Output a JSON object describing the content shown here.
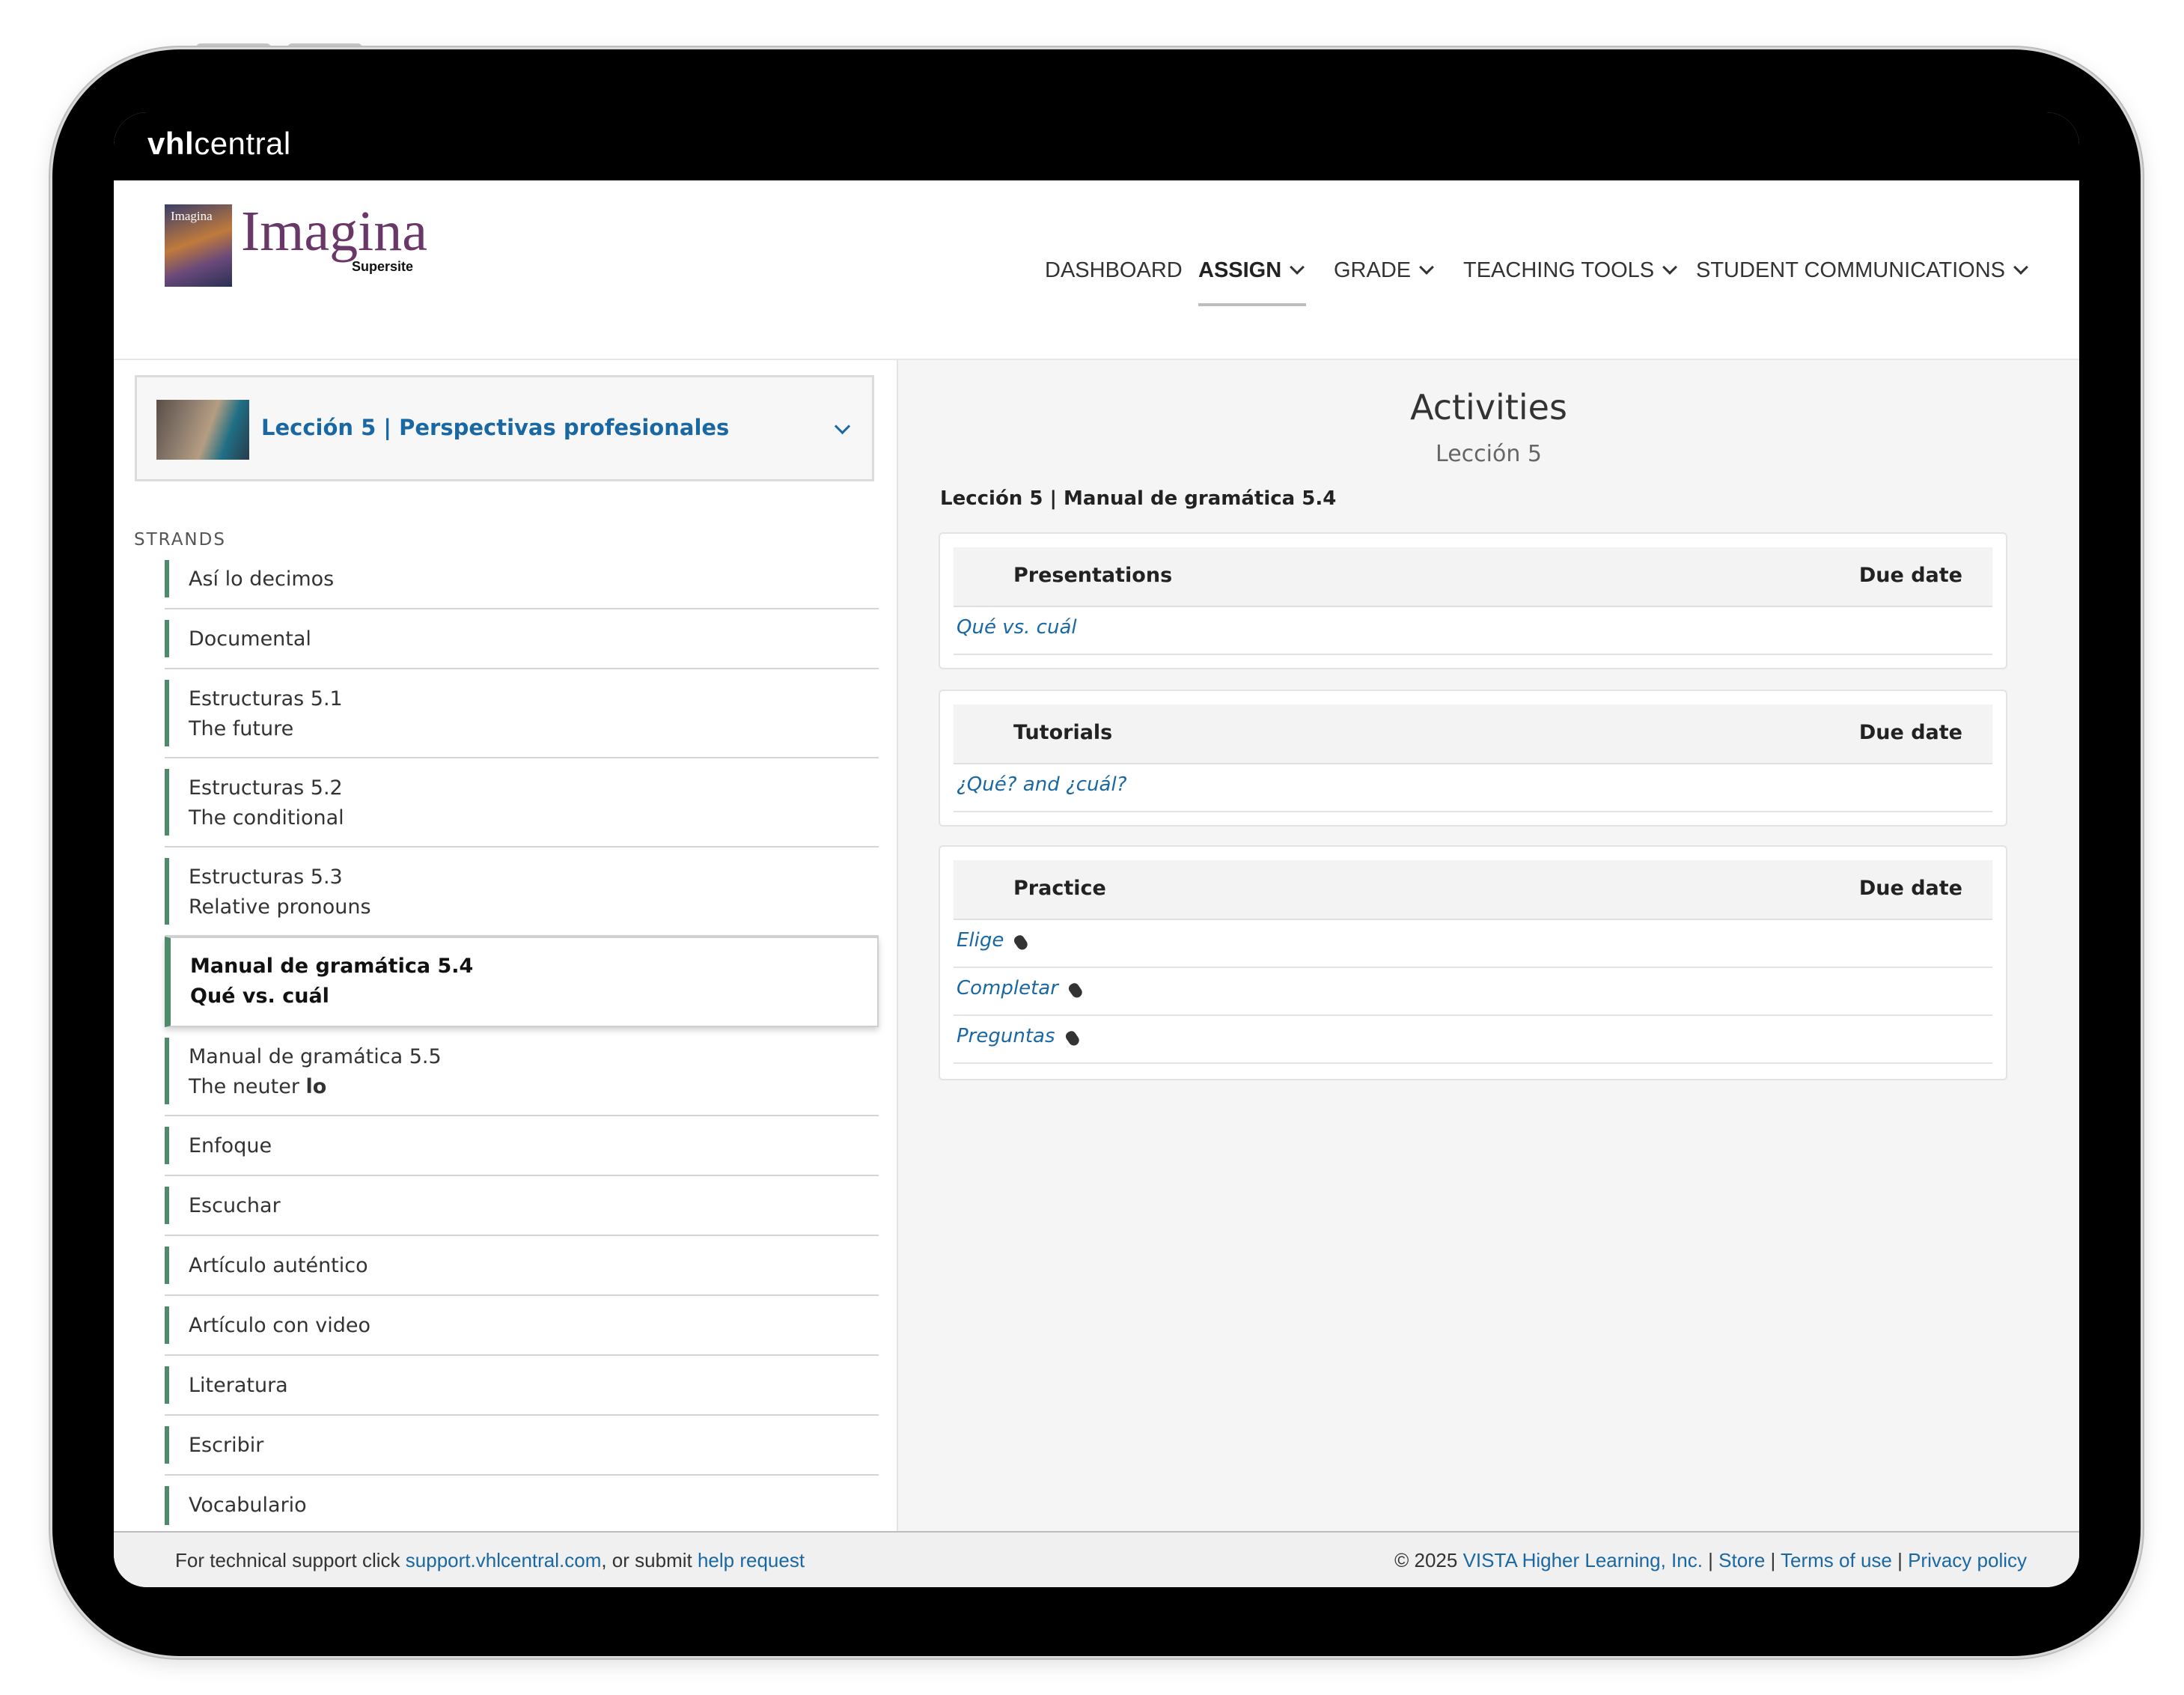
{
  "topbar": {
    "brand_bold": "vhl",
    "brand_rest": "central"
  },
  "header": {
    "cover_text": "Imagina",
    "logo_text": "Imagina",
    "supersite": "Supersite",
    "nav": [
      "DASHBOARD",
      "ASSIGN",
      "GRADE",
      "TEACHING TOOLS",
      "STUDENT COMMUNICATIONS"
    ]
  },
  "sidebar": {
    "lesson_title": "Lección 5 | Perspectivas profesionales",
    "strands_label": "STRANDS",
    "strands": [
      {
        "line1": "Así lo decimos",
        "line2": ""
      },
      {
        "line1": "Documental",
        "line2": ""
      },
      {
        "line1": "Estructuras 5.1",
        "line2": "The future"
      },
      {
        "line1": "Estructuras 5.2",
        "line2": "The conditional"
      },
      {
        "line1": "Estructuras 5.3",
        "line2": "Relative pronouns"
      },
      {
        "line1": "Manual de gramática 5.4",
        "line2": "Qué vs. cuál"
      },
      {
        "line1": "Manual de gramática 5.5",
        "line2": "The neuter lo"
      },
      {
        "line1": "Enfoque",
        "line2": ""
      },
      {
        "line1": "Escuchar",
        "line2": ""
      },
      {
        "line1": "Artículo auténtico",
        "line2": ""
      },
      {
        "line1": "Artículo con video",
        "line2": ""
      },
      {
        "line1": "Literatura",
        "line2": ""
      },
      {
        "line1": "Escribir",
        "line2": ""
      },
      {
        "line1": "Vocabulario",
        "line2": ""
      }
    ]
  },
  "main": {
    "title": "Activities",
    "subtitle": "Lección 5",
    "breadcrumb": "Lección 5 | Manual de gramática 5.4",
    "due_label": "Due date",
    "panels": [
      {
        "title": "Presentations",
        "items": [
          "Qué vs. cuál"
        ]
      },
      {
        "title": "Tutorials",
        "items": [
          "¿Qué? and ¿cuál?"
        ]
      },
      {
        "title": "Practice",
        "items": [
          "Elige",
          "Completar",
          "Preguntas"
        ]
      }
    ]
  },
  "footer": {
    "support_prefix": "For technical support click ",
    "support_link": "support.vhlcentral.com",
    "support_mid": ", or submit ",
    "help_link": "help request",
    "copyright": "© 2025 ",
    "company_link": "VISTA Higher Learning, Inc.",
    "sep": " | ",
    "store_link": "Store",
    "terms_link": "Terms of use",
    "privacy_link": "Privacy policy"
  },
  "colors": {
    "accent": "#1a68a3",
    "strand_bar": "#4f8a6a",
    "brand": "#6a3769"
  }
}
